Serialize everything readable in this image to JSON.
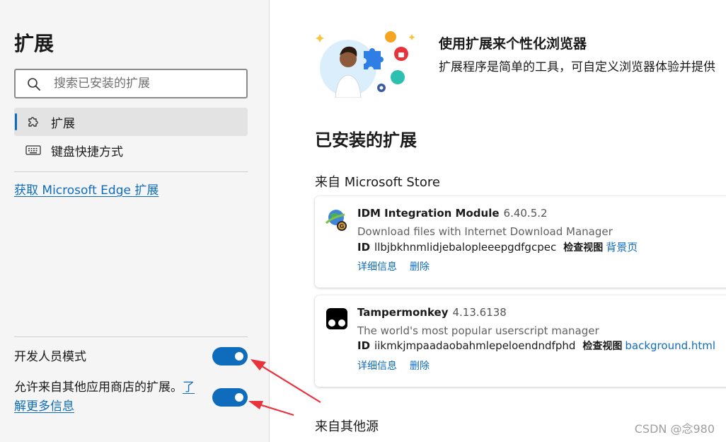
{
  "sidebar": {
    "title": "扩展",
    "search": {
      "placeholder": "搜索已安装的扩展",
      "value": ""
    },
    "nav": [
      {
        "label": "扩展",
        "icon": "puzzle-icon",
        "active": true
      },
      {
        "label": "键盘快捷方式",
        "icon": "keyboard-icon",
        "active": false
      }
    ],
    "get_extensions_link": "获取 Microsoft Edge 扩展",
    "developer_mode": {
      "label": "开发人员模式",
      "enabled": true
    },
    "allow_other_stores": {
      "label": "允许来自其他应用商店的扩展。",
      "link": "了解更多信息",
      "enabled": true
    }
  },
  "main": {
    "hero": {
      "title": "使用扩展来个性化浏览器",
      "description": "扩展程序是简单的工具，可自定义浏览器体验并提供"
    },
    "installed_title": "已安装的扩展",
    "from_store_label": "来自 Microsoft Store",
    "from_other_label": "来自其他源",
    "extensions": [
      {
        "name": "IDM Integration Module",
        "version": "6.40.5.2",
        "description": "Download files with Internet Download Manager",
        "id_label": "ID",
        "id": "llbjbkhnmlidjebalopleeepgdfgcpec",
        "inspect_label": "检查视图",
        "inspect_link": "背景页",
        "details_label": "详细信息",
        "remove_label": "删除",
        "icon": "idm-globe-icon"
      },
      {
        "name": "Tampermonkey",
        "version": "4.13.6138",
        "description": "The world's most popular userscript manager",
        "id_label": "ID",
        "id": "iikmkjmpaadaobahmlepeloendndfphd",
        "inspect_label": "检查视图",
        "inspect_link": "background.html",
        "details_label": "详细信息",
        "remove_label": "删除",
        "icon": "tampermonkey-icon"
      }
    ]
  },
  "watermark": "CSDN @念980",
  "colors": {
    "accent": "#0f6cbd",
    "sidebar_bg": "#f5f5f5",
    "annotation_arrow": "#e8323c"
  }
}
